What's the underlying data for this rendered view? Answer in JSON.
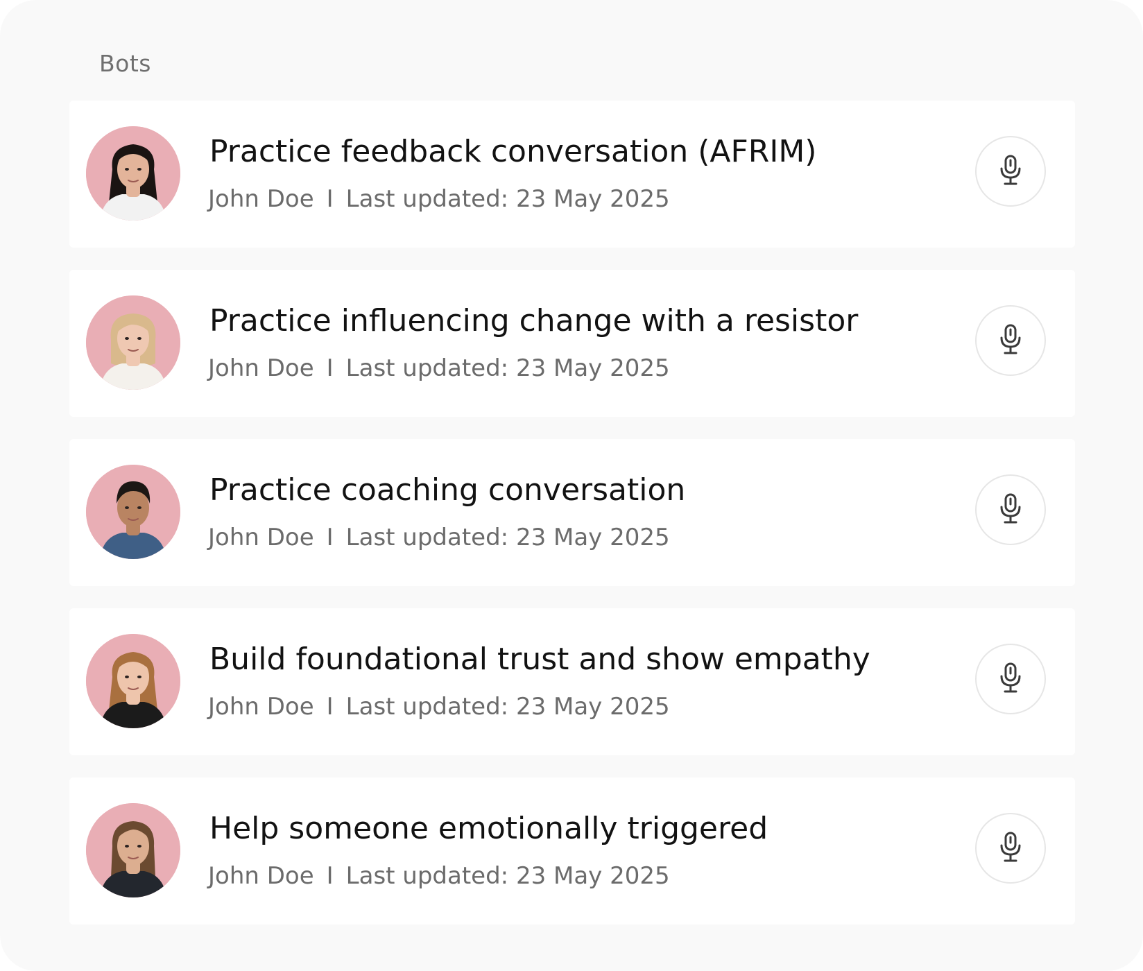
{
  "section": {
    "title": "Bots"
  },
  "colors": {
    "panel_bg": "#f9f9f9",
    "card_bg": "#ffffff",
    "avatar_bg": "#e9aeb5",
    "title_text": "#121212",
    "meta_text": "#6b6b6b",
    "mic_border": "#e6e6e6"
  },
  "bots": [
    {
      "title": "Practice feedback conversation (AFRIM)",
      "author": "John Doe",
      "separator": "I",
      "updated": "Last updated: 23 May 2025",
      "avatar": {
        "hair": "#1a1412",
        "skin": "#e3b49a",
        "shirt": "#f2f2f2",
        "hair_style": "long"
      },
      "action_icon": "microphone-icon"
    },
    {
      "title": "Practice influencing change with a resistor",
      "author": "John Doe",
      "separator": "I",
      "updated": "Last updated: 23 May 2025",
      "avatar": {
        "hair": "#d9b98c",
        "skin": "#efc8b2",
        "shirt": "#f4f1ec",
        "hair_style": "bob"
      },
      "action_icon": "microphone-icon"
    },
    {
      "title": "Practice coaching conversation",
      "author": "John Doe",
      "separator": "I",
      "updated": "Last updated: 23 May 2025",
      "avatar": {
        "hair": "#1c1714",
        "skin": "#b98462",
        "shirt": "#3f5f86",
        "hair_style": "short"
      },
      "action_icon": "microphone-icon"
    },
    {
      "title": "Build foundational trust and show empathy",
      "author": "John Doe",
      "separator": "I",
      "updated": "Last updated: 23 May 2025",
      "avatar": {
        "hair": "#a9703f",
        "skin": "#eec5ac",
        "shirt": "#1b1b1b",
        "hair_style": "long"
      },
      "action_icon": "microphone-icon"
    },
    {
      "title": "Help someone emotionally triggered",
      "author": "John Doe",
      "separator": "I",
      "updated": "Last updated: 23 May 2025",
      "avatar": {
        "hair": "#6b4a30",
        "skin": "#dcae90",
        "shirt": "#23272e",
        "hair_style": "medium"
      },
      "action_icon": "microphone-icon"
    }
  ]
}
